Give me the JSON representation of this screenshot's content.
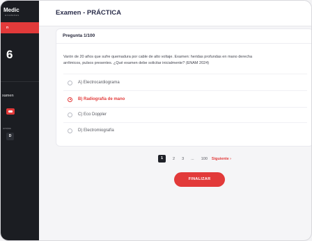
{
  "sidebar": {
    "logo": "Medic",
    "logo_sub": "EXAMENES",
    "active_tab": "n",
    "big_number": "6",
    "section_label": "xamen",
    "small_label": "uestas",
    "badge": "D"
  },
  "header": {
    "title": "Examen - PRÁCTICA"
  },
  "question": {
    "counter": "Pregunta 1/100",
    "text_line1": "Varón de 20 años que sufre quemadura por cable de alto voltaje. Examen: heridas profundas en mano derecha",
    "text_line2": "arrítmicos, pulsos presentes. ¿Qué examen debe solicitar inicialmente? (ENAM 2024)",
    "options": [
      {
        "label": "A) Electrocardiograma",
        "selected": false
      },
      {
        "label": "B) Radiografía de mano",
        "selected": true
      },
      {
        "label": "C) Eco Doppler",
        "selected": false
      },
      {
        "label": "D) Electromiografía",
        "selected": false
      }
    ]
  },
  "pagination": {
    "pages": [
      "1",
      "2",
      "3",
      "...",
      "100"
    ],
    "current": "1",
    "next_label": "Siguiente ›"
  },
  "finish_button": "FINALIZAR",
  "colors": {
    "accent": "#e23a3a",
    "sidebar": "#1b1d22",
    "title": "#2a2d4a"
  }
}
